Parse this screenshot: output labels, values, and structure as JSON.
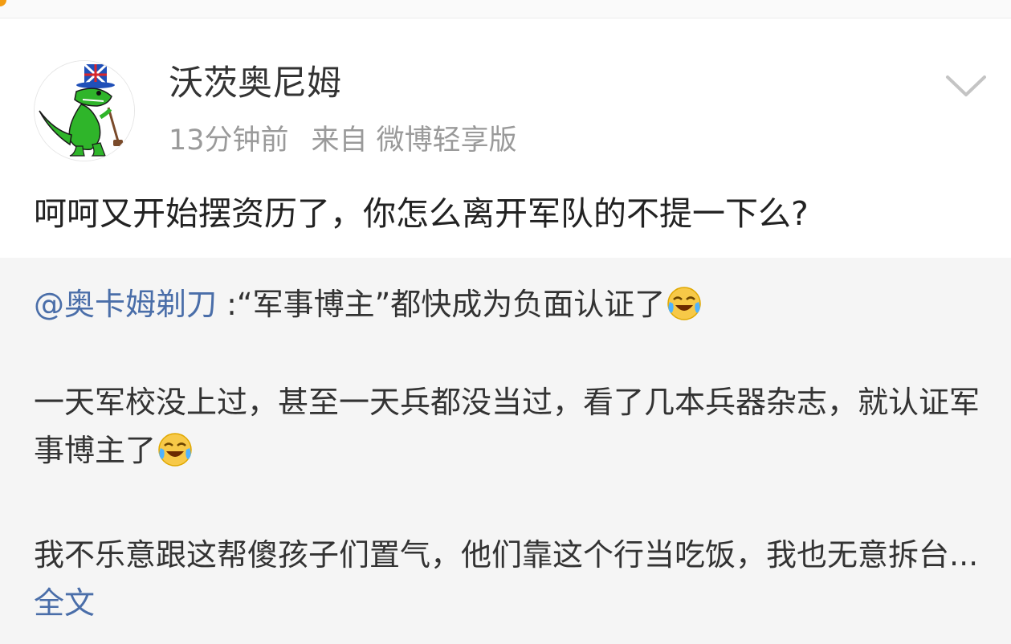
{
  "post": {
    "username": "沃茨奥尼姆",
    "time": "13分钟前",
    "source": "来自 微博轻享版",
    "text": "呵呵又开始摆资历了，你怎么离开军队的不提一下么?"
  },
  "repost": {
    "mention": "@奥卡姆剃刀",
    "p1_text": " :“军事博主”都快成为负面认证了",
    "p2_text": "一天军校没上过，甚至一天兵都没当过，看了几本兵器杂志，就认证军事博主了",
    "p3_text": "我不乐意跟这帮傻孩子们置气，他们靠这个行当吃饭，我也无意拆台... ",
    "full_text_link": "全文",
    "emoji_name": "laugh-cry-icon"
  },
  "colors": {
    "link": "#4a6ea9",
    "meta": "#9a9a9a",
    "repost_bg": "#f5f5f5"
  }
}
